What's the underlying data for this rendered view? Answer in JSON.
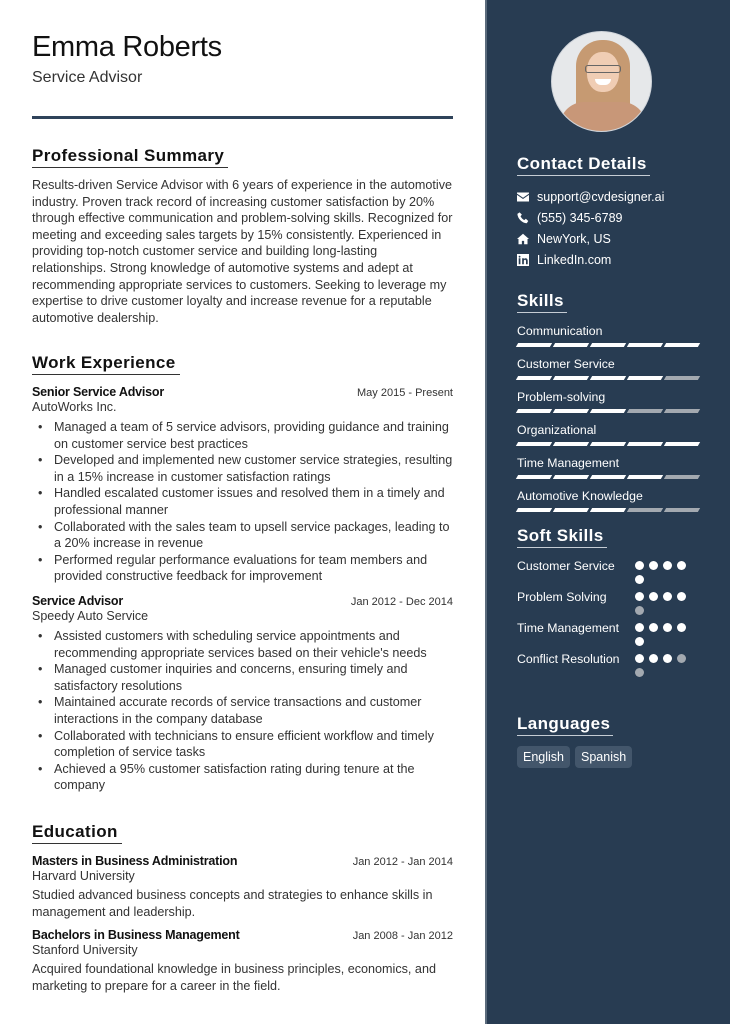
{
  "header": {
    "name": "Emma Roberts",
    "title": "Service Advisor"
  },
  "summary": {
    "heading": "Professional Summary",
    "text": "Results-driven Service Advisor with 6 years of experience in the automotive industry. Proven track record of increasing customer satisfaction by 20% through effective communication and problem-solving skills. Recognized for meeting and exceeding sales targets by 15% consistently. Experienced in providing top-notch customer service and building long-lasting relationships. Strong knowledge of automotive systems and adept at recommending appropriate services to customers. Seeking to leverage my expertise to drive customer loyalty and increase revenue for a reputable automotive dealership."
  },
  "experience": {
    "heading": "Work Experience",
    "jobs": [
      {
        "title": "Senior Service Advisor",
        "date": "May 2015 - Present",
        "company": "AutoWorks Inc.",
        "bullets": [
          "Managed a team of 5 service advisors, providing guidance and training on customer service best practices",
          "Developed and implemented new customer service strategies, resulting in a 15% increase in customer satisfaction ratings",
          "Handled escalated customer issues and resolved them in a timely and professional manner",
          "Collaborated with the sales team to upsell service packages, leading to a 20% increase in revenue",
          "Performed regular performance evaluations for team members and provided constructive feedback for improvement"
        ]
      },
      {
        "title": "Service Advisor",
        "date": "Jan 2012 - Dec 2014",
        "company": "Speedy Auto Service",
        "bullets": [
          "Assisted customers with scheduling service appointments and recommending appropriate services based on their vehicle's needs",
          "Managed customer inquiries and concerns, ensuring timely and satisfactory resolutions",
          "Maintained accurate records of service transactions and customer interactions in the company database",
          "Collaborated with technicians to ensure efficient workflow and timely completion of service tasks",
          "Achieved a 95% customer satisfaction rating during tenure at the company"
        ]
      }
    ]
  },
  "education": {
    "heading": "Education",
    "items": [
      {
        "degree": "Masters in Business Administration",
        "date": "Jan 2012 - Jan 2014",
        "school": "Harvard University",
        "description": "Studied advanced business concepts and strategies to enhance skills in management and leadership."
      },
      {
        "degree": "Bachelors in Business Management",
        "date": "Jan 2008 - Jan 2012",
        "school": "Stanford University",
        "description": "Acquired foundational knowledge in business principles, economics, and marketing to prepare for a career in the field."
      }
    ]
  },
  "sidebar": {
    "avatar_alt": "Profile photo of Emma Roberts",
    "contact": {
      "heading": "Contact Details",
      "items": [
        {
          "icon": "envelope-icon",
          "text": "support@cvdesigner.ai"
        },
        {
          "icon": "phone-icon",
          "text": "(555) 345-6789"
        },
        {
          "icon": "home-icon",
          "text": "NewYork, US"
        },
        {
          "icon": "linkedin-icon",
          "text": "LinkedIn.com"
        }
      ]
    },
    "skills": {
      "heading": "Skills",
      "max": 5,
      "items": [
        {
          "name": "Communication",
          "level": 5
        },
        {
          "name": "Customer Service",
          "level": 4
        },
        {
          "name": "Problem-solving",
          "level": 3
        },
        {
          "name": "Organizational",
          "level": 5
        },
        {
          "name": "Time Management",
          "level": 4
        },
        {
          "name": "Automotive Knowledge",
          "level": 3
        }
      ]
    },
    "soft_skills": {
      "heading": "Soft Skills",
      "max": 5,
      "items": [
        {
          "name": "Customer Service",
          "level": 5
        },
        {
          "name": "Problem Solving",
          "level": 4
        },
        {
          "name": "Time Management",
          "level": 5
        },
        {
          "name": "Conflict Resolution",
          "level": 3
        }
      ]
    },
    "languages": {
      "heading": "Languages",
      "items": [
        "English",
        "Spanish"
      ]
    }
  },
  "colors": {
    "sidebar_bg": "#283c52",
    "accent_line": "#2f435a",
    "rating_on": "#ffffff",
    "rating_off": "#a3a9b0",
    "language_chip": "#43566b"
  }
}
